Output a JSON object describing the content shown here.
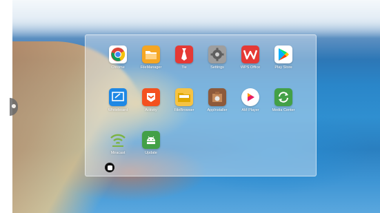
{
  "launcher": {
    "apps": [
      {
        "label": "Chrome",
        "icon": "chrome-icon",
        "color": "#ffffff"
      },
      {
        "label": "FileManager",
        "icon": "folder-icon",
        "color": "#f5a623"
      },
      {
        "label": "Tie",
        "icon": "tie-icon",
        "color": "#e53935"
      },
      {
        "label": "Settings",
        "icon": "gear-icon",
        "color": "#8e8e8e"
      },
      {
        "label": "WPS Office",
        "icon": "wps-office-icon",
        "color": "#e53935"
      },
      {
        "label": "Play Store",
        "icon": "play-store-icon",
        "color": "#ffffff"
      },
      {
        "label": "Whiteboard",
        "icon": "whiteboard-icon",
        "color": "#1e88e5"
      },
      {
        "label": "Activity",
        "icon": "activity-icon",
        "color": "#f4511e"
      },
      {
        "label": "FileBrowser",
        "icon": "file-browser-icon",
        "color": "#f6c343"
      },
      {
        "label": "AppInstaller",
        "icon": "app-installer-icon",
        "color": "#8d5a3b"
      },
      {
        "label": "AM Player",
        "icon": "am-player-icon",
        "color": "#ffffff"
      },
      {
        "label": "Media Center",
        "icon": "media-center-icon",
        "color": "#43a047"
      },
      {
        "label": "Miracast",
        "icon": "miracast-icon",
        "color": "#7cb342"
      },
      {
        "label": "Update",
        "icon": "android-icon",
        "color": "#43a047"
      }
    ]
  }
}
